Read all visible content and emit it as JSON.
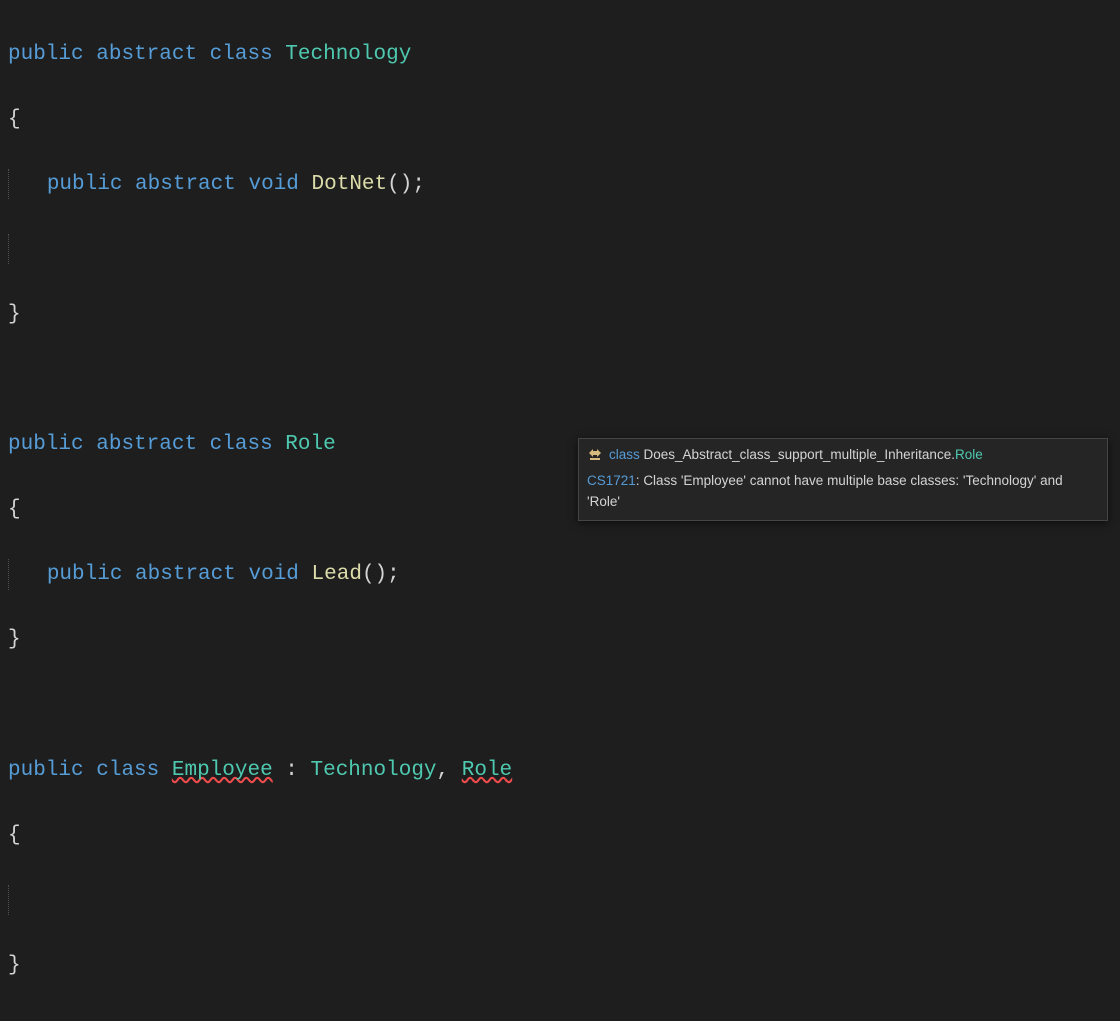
{
  "code": {
    "kw_public": "public",
    "kw_abstract": "abstract",
    "kw_class": "class",
    "kw_void": "void",
    "type_technology": "Technology",
    "type_role": "Role",
    "type_employee": "Employee",
    "method_dotnet": "DotNet",
    "method_lead": "Lead",
    "brace_open": "{",
    "brace_close": "}",
    "parens": "();",
    "colon": " : ",
    "comma": ", "
  },
  "tooltip": {
    "kw_class": "class",
    "qualified_prefix": "Does_Abstract_class_support_multiple_Inheritance.",
    "qualified_type": "Role",
    "error_code": "CS1721",
    "error_sep": ": ",
    "error_msg": "Class 'Employee' cannot have multiple base classes: 'Technology' and 'Role'"
  }
}
